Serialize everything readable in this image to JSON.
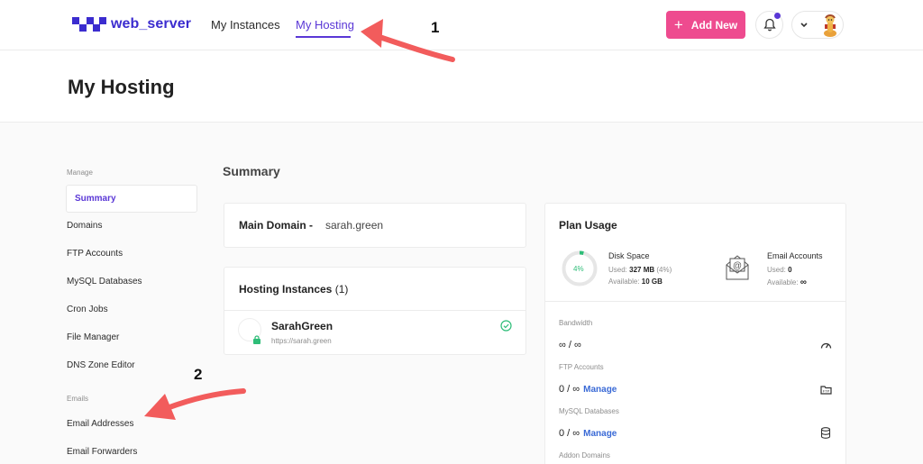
{
  "app": {
    "logo_text": "web_server"
  },
  "nav": {
    "instances": "My Instances",
    "hosting": "My Hosting"
  },
  "header": {
    "add_new": "Add New"
  },
  "page": {
    "title": "My Hosting",
    "section_title": "Summary"
  },
  "sidebar": {
    "manage_label": "Manage",
    "items": [
      "Summary",
      "Domains",
      "FTP Accounts",
      "MySQL Databases",
      "Cron Jobs",
      "File Manager",
      "DNS Zone Editor"
    ],
    "emails_label": "Emails",
    "email_items": [
      "Email Addresses",
      "Email Forwarders"
    ]
  },
  "main_domain": {
    "label": "Main Domain -",
    "value": "sarah.green"
  },
  "hosting_instances": {
    "title": "Hosting Instances",
    "count": "(1)",
    "instance": {
      "name": "SarahGreen",
      "url": "https://sarah.green"
    }
  },
  "plan_usage": {
    "title": "Plan Usage",
    "disk": {
      "percent": "4%",
      "percent_value": 0.04,
      "label": "Disk Space",
      "used_label": "Used:",
      "used_value": "327 MB",
      "used_pct": "(4%)",
      "available_label": "Available:",
      "available_value": "10 GB"
    },
    "email": {
      "label": "Email Accounts",
      "used_label": "Used:",
      "used_value": "0",
      "available_label": "Available:"
    },
    "bandwidth": {
      "label": "Bandwidth",
      "value": "∞ / ∞"
    },
    "ftp": {
      "label": "FTP Accounts",
      "value": "0 / ∞",
      "manage": "Manage"
    },
    "mysql": {
      "label": "MySQL Databases",
      "value": "0 / ∞",
      "manage": "Manage"
    },
    "addon": {
      "label": "Addon Domains"
    }
  },
  "annotations": {
    "one": "1",
    "two": "2"
  },
  "colors": {
    "accent": "#5a37d6",
    "add_button": "#ee4b8f",
    "arrow": "#f25c5c",
    "success": "#2ebd78"
  }
}
